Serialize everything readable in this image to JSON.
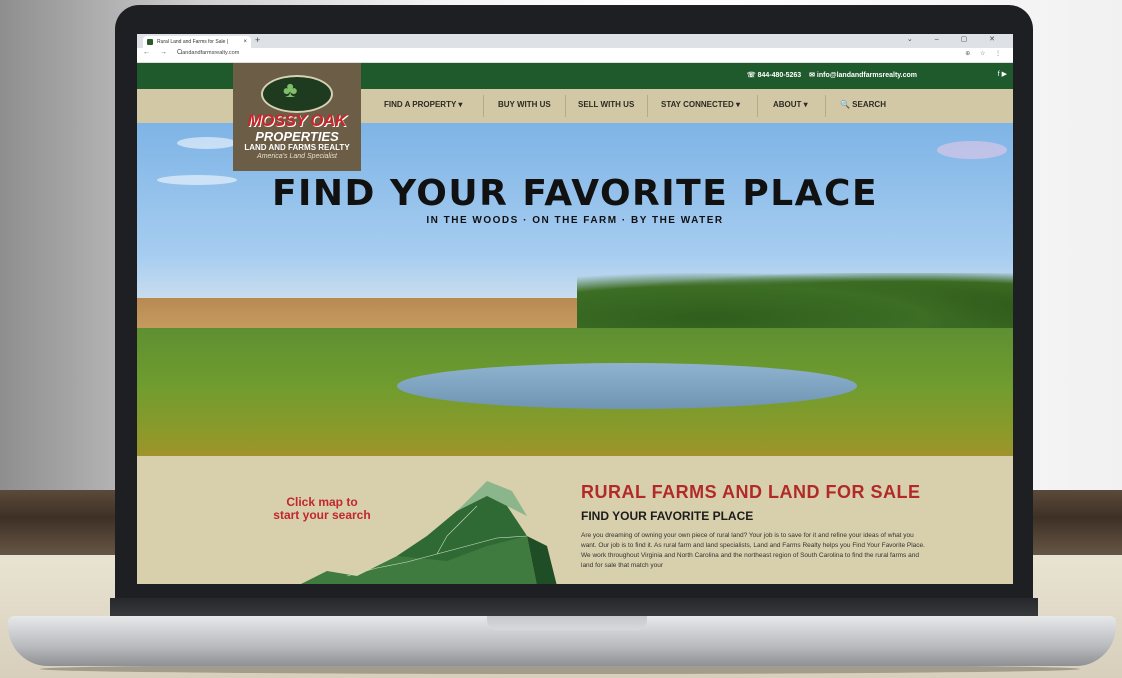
{
  "browser": {
    "tab_title": "Rural Land and Farms for Sale | ",
    "tab_close": "×",
    "new_tab": "+",
    "window_controls": "⌄ – ▢ ✕",
    "nav_buttons": "← → C",
    "url": "landandfarmsrealty.com",
    "address_icons": "⊕ ☆ ⋮"
  },
  "topbar": {
    "phone": "☏ 844-480-5263",
    "email": "✉ info@landandfarmsrealty.com",
    "social": "f ▶"
  },
  "logo": {
    "brand": "MOSSY OAK",
    "properties": "PROPERTIES",
    "subtitle": "LAND AND FARMS REALTY",
    "tagline": "America's Land Specialist"
  },
  "nav": {
    "items": [
      {
        "label": "FIND A PROPERTY ▾"
      },
      {
        "label": "BUY WITH US"
      },
      {
        "label": "SELL WITH US"
      },
      {
        "label": "STAY CONNECTED ▾"
      },
      {
        "label": "ABOUT ▾"
      },
      {
        "label": "🔍 SEARCH"
      }
    ]
  },
  "hero": {
    "title": "FIND YOUR FAVORITE PLACE",
    "subtitle": "IN THE WOODS · ON THE FARM · BY THE WATER"
  },
  "content": {
    "map_prompt_line1": "Click map to",
    "map_prompt_line2": "start your search",
    "heading": "RURAL FARMS AND LAND FOR SALE",
    "subheading": "FIND YOUR FAVORITE PLACE",
    "paragraph": "Are you dreaming of owning your own piece of rural land? Your job is to save for it and refine your ideas of what you want. Our job is to find it. As rural farm and land specialists, Land and Farms Realty helps you Find Your Favorite Place. We work throughout Virginia and North Carolina and the northeast region of South Carolina to find the rural farms and land for sale that match your"
  },
  "colors": {
    "topbar_green": "#1f5a2c",
    "nav_tan": "#d2c8a6",
    "logo_brown": "#6b5d46",
    "accent_red": "#c1272d"
  }
}
